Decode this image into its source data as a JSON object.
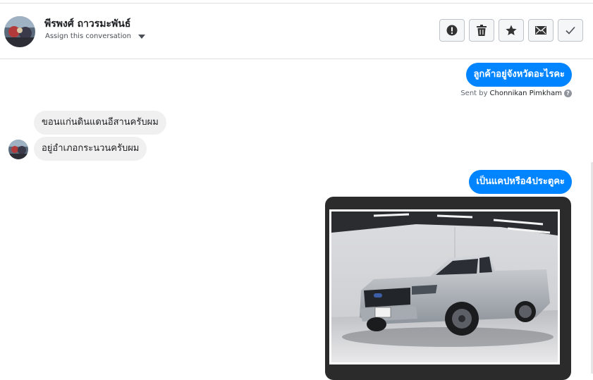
{
  "header": {
    "contact_name": "พีรพงศ์ ถาวรมะพันธ์",
    "assign_label": "Assign this conversation",
    "actions": [
      {
        "name": "mark-spam-button",
        "icon": "alert-icon"
      },
      {
        "name": "delete-button",
        "icon": "trash-icon"
      },
      {
        "name": "star-button",
        "icon": "star-icon"
      },
      {
        "name": "mark-unread-button",
        "icon": "mail-icon"
      },
      {
        "name": "mark-done-button",
        "icon": "check-icon"
      }
    ]
  },
  "messages": {
    "out_1": "ลูกค้าอยู่จังหวัดอะไรคะ",
    "sent_by_prefix": "Sent by",
    "sent_by_name": "Chonnikan Pimkham",
    "in_1": "ขอนแก่นดินแดนอีสานครับผม",
    "in_2": "อยู่อำเภอกระนวนครับผม",
    "out_2": "เป็นแคปหรือ4ประตูคะ"
  },
  "colors": {
    "outgoing_bubble": "#0084ff",
    "incoming_bubble": "#f1f0f0"
  }
}
